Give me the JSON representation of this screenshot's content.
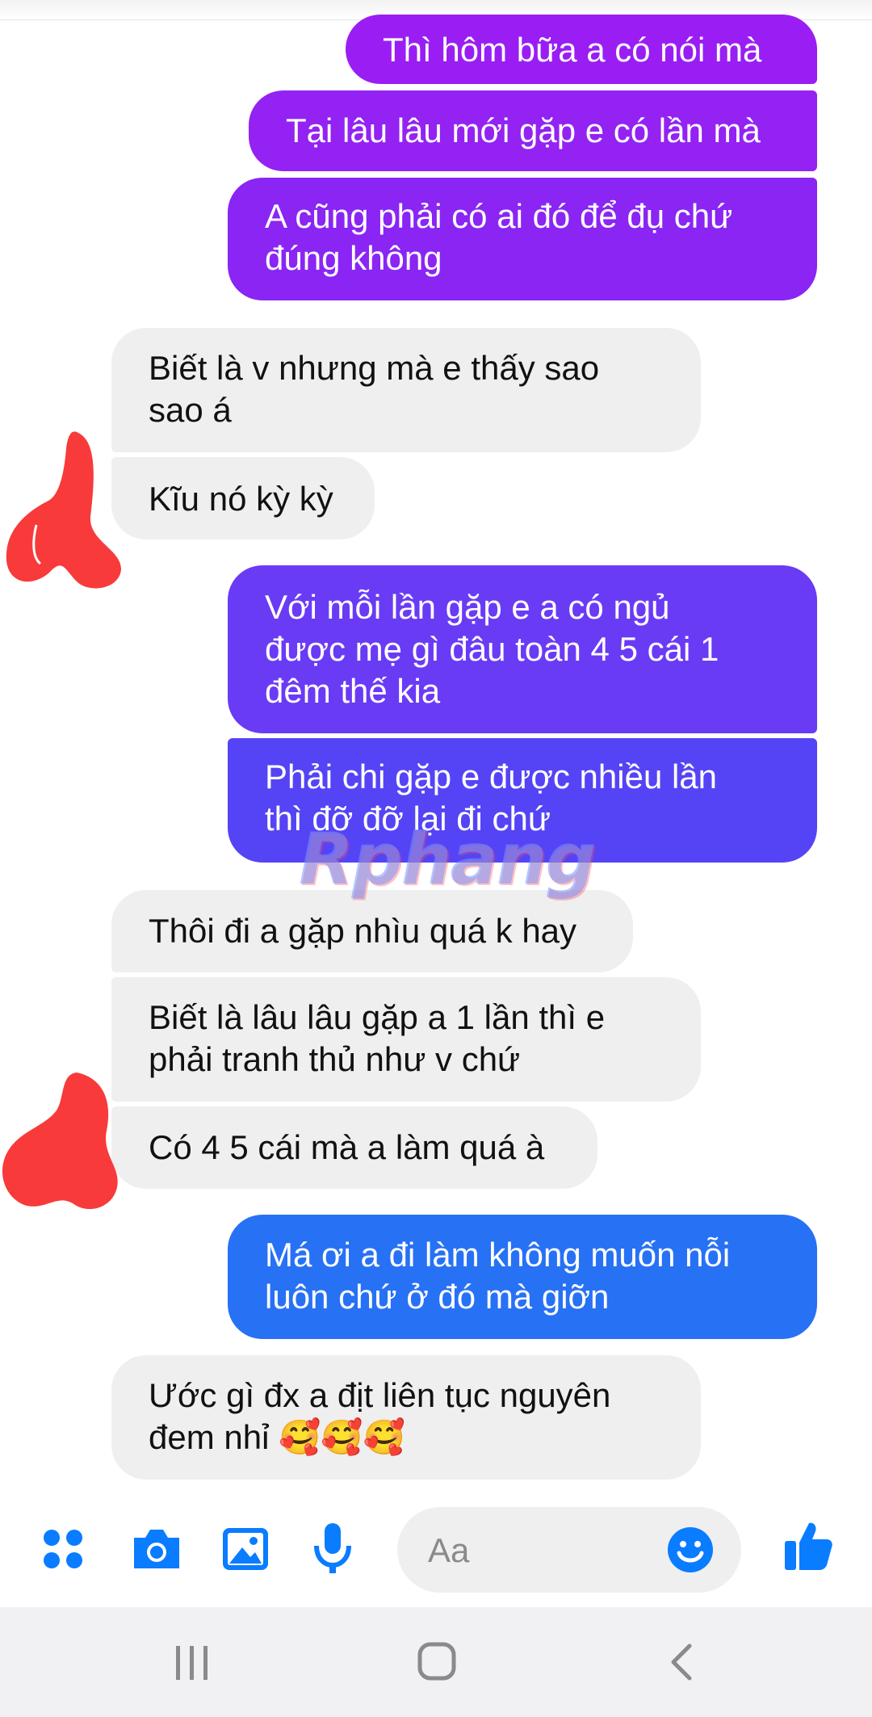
{
  "messages": [
    {
      "side": "out",
      "text": "Thì hôm bữa a có nói mà"
    },
    {
      "side": "out",
      "text": "Tại lâu lâu mới gặp e có lần mà"
    },
    {
      "side": "out",
      "text": "A cũng phải có ai đó để đụ chứ\nđúng không"
    },
    {
      "side": "in",
      "text": "Biết là v nhưng mà e thấy sao\nsao á"
    },
    {
      "side": "in",
      "text": "Kĩu nó kỳ kỳ"
    },
    {
      "side": "out",
      "text": "Với mỗi lần gặp e a có ngủ\nđược mẹ gì đâu toàn 4 5 cái 1\nđêm thế kia"
    },
    {
      "side": "out",
      "text": "Phải chi gặp e được nhiều lần\nthì đỡ đỡ lại đi chứ"
    },
    {
      "side": "in",
      "text": "Thôi đi a gặp nhìu quá k hay"
    },
    {
      "side": "in",
      "text": "Biết là lâu lâu gặp a 1 lần thì e\nphải tranh thủ như v chứ"
    },
    {
      "side": "in",
      "text": "Có 4 5 cái mà a làm quá à"
    },
    {
      "side": "out",
      "text": "Má ơi a đi làm không muốn nỗi\nluôn chứ ở đó mà giỡn"
    },
    {
      "side": "in",
      "text": "Ước gì đx a địt liên tục nguyên\nđem nhỉ 🥰🥰🥰"
    }
  ],
  "watermark": "Rphang",
  "composer": {
    "placeholder": "Aa",
    "icons": [
      "menu-icon",
      "camera-icon",
      "image-icon",
      "microphone-icon",
      "emoji-icon",
      "thumbs-up-icon"
    ]
  },
  "navbar": {
    "icons": [
      "recent-apps-icon",
      "home-icon",
      "back-icon"
    ]
  },
  "colors": {
    "accent": "#0a7cff",
    "incoming_bg": "#efefef",
    "gradient_top": "#9b1ff5",
    "gradient_mid": "#5b3df5",
    "gradient_bottom": "#1f74f5"
  }
}
